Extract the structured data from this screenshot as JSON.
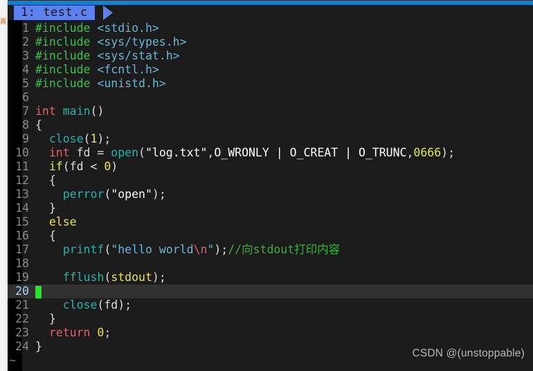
{
  "window": {
    "accent_color": "#0b82d4",
    "background_color": "#1b1b1b"
  },
  "tabline": {
    "active_tab": {
      "label": "1: test.c",
      "background_color": "#5d81f0",
      "text_color": "#101010"
    }
  },
  "editor": {
    "name": "vim",
    "current_line_number": 20,
    "current_line_highlight_color": "#303030",
    "cursor_color": "#22e722",
    "filler_char": "~",
    "lines": [
      {
        "n": "1",
        "tokens": [
          {
            "t": "#include ",
            "c": "k-pre"
          },
          {
            "t": "<stdio.h>",
            "c": "k-hdr"
          }
        ]
      },
      {
        "n": "2",
        "tokens": [
          {
            "t": "#include ",
            "c": "k-pre"
          },
          {
            "t": "<sys/types.h>",
            "c": "k-hdr"
          }
        ]
      },
      {
        "n": "3",
        "tokens": [
          {
            "t": "#include ",
            "c": "k-pre"
          },
          {
            "t": "<sys/stat.h>",
            "c": "k-hdr"
          }
        ]
      },
      {
        "n": "4",
        "tokens": [
          {
            "t": "#include ",
            "c": "k-pre"
          },
          {
            "t": "<fcntl.h>",
            "c": "k-hdr"
          }
        ]
      },
      {
        "n": "5",
        "tokens": [
          {
            "t": "#include ",
            "c": "k-pre"
          },
          {
            "t": "<unistd.h>",
            "c": "k-hdr"
          }
        ]
      },
      {
        "n": "6",
        "tokens": []
      },
      {
        "n": "7",
        "tokens": [
          {
            "t": "int ",
            "c": "k-type"
          },
          {
            "t": "main",
            "c": "k-fn"
          },
          {
            "t": "()",
            "c": "k-punct"
          }
        ]
      },
      {
        "n": "8",
        "tokens": [
          {
            "t": "{",
            "c": "k-punct"
          }
        ]
      },
      {
        "n": "9",
        "tokens": [
          {
            "t": "  ",
            "c": "k-punct"
          },
          {
            "t": "close",
            "c": "k-fn"
          },
          {
            "t": "(",
            "c": "k-punct"
          },
          {
            "t": "1",
            "c": "k-num"
          },
          {
            "t": ");",
            "c": "k-punct"
          }
        ]
      },
      {
        "n": "10",
        "tokens": [
          {
            "t": "  ",
            "c": "k-punct"
          },
          {
            "t": "int ",
            "c": "k-type"
          },
          {
            "t": "fd = ",
            "c": "k-punct"
          },
          {
            "t": "open",
            "c": "k-fn"
          },
          {
            "t": "(",
            "c": "k-punct"
          },
          {
            "t": "\"log.txt\"",
            "c": "k-str"
          },
          {
            "t": ",",
            "c": "k-punct"
          },
          {
            "t": "O_WRONLY | O_CREAT | O_TRUNC",
            "c": "k-macro"
          },
          {
            "t": ",",
            "c": "k-punct"
          },
          {
            "t": "0666",
            "c": "k-num"
          },
          {
            "t": ");",
            "c": "k-punct"
          }
        ]
      },
      {
        "n": "11",
        "tokens": [
          {
            "t": "  ",
            "c": "k-punct"
          },
          {
            "t": "if",
            "c": "k-ctl"
          },
          {
            "t": "(fd < ",
            "c": "k-punct"
          },
          {
            "t": "0",
            "c": "k-num"
          },
          {
            "t": ")",
            "c": "k-punct"
          }
        ]
      },
      {
        "n": "12",
        "tokens": [
          {
            "t": "  {",
            "c": "k-punct"
          }
        ]
      },
      {
        "n": "13",
        "tokens": [
          {
            "t": "    ",
            "c": "k-punct"
          },
          {
            "t": "perror",
            "c": "k-fn"
          },
          {
            "t": "(",
            "c": "k-punct"
          },
          {
            "t": "\"open\"",
            "c": "k-str"
          },
          {
            "t": ");",
            "c": "k-punct"
          }
        ]
      },
      {
        "n": "14",
        "tokens": [
          {
            "t": "  }",
            "c": "k-punct"
          }
        ]
      },
      {
        "n": "15",
        "tokens": [
          {
            "t": "  ",
            "c": "k-punct"
          },
          {
            "t": "else",
            "c": "k-ctl"
          }
        ]
      },
      {
        "n": "16",
        "tokens": [
          {
            "t": "  {",
            "c": "k-punct"
          }
        ]
      },
      {
        "n": "17",
        "tokens": [
          {
            "t": "    ",
            "c": "k-punct"
          },
          {
            "t": "printf",
            "c": "k-fn"
          },
          {
            "t": "(",
            "c": "k-punct"
          },
          {
            "t": "\"hello world",
            "c": "k-str2"
          },
          {
            "t": "\\n",
            "c": "k-esc"
          },
          {
            "t": "\"",
            "c": "k-str2"
          },
          {
            "t": ");",
            "c": "k-punct"
          },
          {
            "t": "//向stdout打印内容",
            "c": "k-com"
          }
        ]
      },
      {
        "n": "18",
        "tokens": []
      },
      {
        "n": "19",
        "tokens": [
          {
            "t": "    ",
            "c": "k-punct"
          },
          {
            "t": "fflush",
            "c": "k-fn"
          },
          {
            "t": "(",
            "c": "k-punct"
          },
          {
            "t": "stdout",
            "c": "k-std"
          },
          {
            "t": ");",
            "c": "k-punct"
          }
        ]
      },
      {
        "n": "20",
        "tokens": [],
        "cursor": true
      },
      {
        "n": "21",
        "tokens": [
          {
            "t": "    ",
            "c": "k-punct"
          },
          {
            "t": "close",
            "c": "k-fn"
          },
          {
            "t": "(fd);",
            "c": "k-punct"
          }
        ]
      },
      {
        "n": "22",
        "tokens": [
          {
            "t": "  }",
            "c": "k-punct"
          }
        ]
      },
      {
        "n": "23",
        "tokens": [
          {
            "t": "  ",
            "c": "k-punct"
          },
          {
            "t": "return ",
            "c": "k-type"
          },
          {
            "t": "0",
            "c": "k-num"
          },
          {
            "t": ";",
            "c": "k-punct"
          }
        ]
      },
      {
        "n": "24",
        "tokens": [
          {
            "t": "}",
            "c": "k-punct"
          }
        ]
      }
    ]
  },
  "watermark": {
    "text": "CSDN @(unstoppable)"
  }
}
